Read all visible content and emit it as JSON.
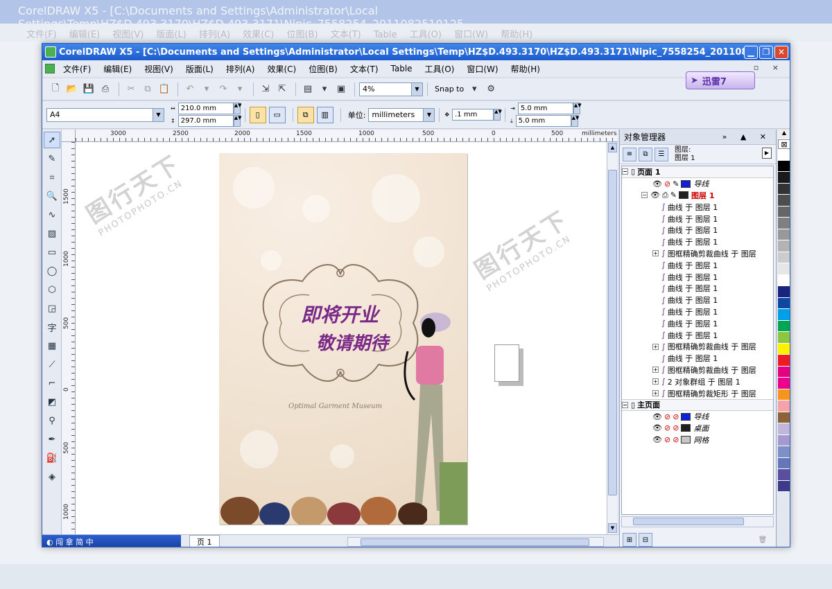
{
  "window": {
    "title": "CorelDRAW X5 - [C:\\Documents and Settings\\Administrator\\Local Settings\\Temp\\HZ$D.493.3170\\HZ$D.493.3171\\Nipic_7558254_2011082510125...",
    "btn_min": "▁",
    "btn_max": "❐",
    "btn_close": "✕"
  },
  "menu": {
    "items": [
      "文件(F)",
      "编辑(E)",
      "视图(V)",
      "版面(L)",
      "排列(A)",
      "效果(C)",
      "位图(B)",
      "文本(T)",
      "Table",
      "工具(O)",
      "窗口(W)",
      "帮助(H)"
    ],
    "mdi": "_ ▫ ×"
  },
  "toolbar": {
    "zoom": "4%",
    "snap": "Snap to",
    "xunlei": "迅雷7"
  },
  "propbar": {
    "paper": "A4",
    "width": "210.0 mm",
    "height": "297.0 mm",
    "unit_label": "单位:",
    "unit": "millimeters",
    "nudge": ".1 mm",
    "dup_x": "5.0 mm",
    "dup_y": "5.0 mm"
  },
  "ruler": {
    "h_labels": [
      "3000",
      "2500",
      "2000",
      "1500",
      "1000",
      "500",
      "0",
      "500"
    ],
    "h_unit": "millimeters",
    "v_labels": [
      "1500",
      "1000",
      "500",
      "0",
      "500",
      "1000"
    ],
    "v_unit": "millimeters"
  },
  "design": {
    "line1": "即将开业",
    "line2": "敬请期待",
    "sub": "Optimal Garment Museum"
  },
  "watermark": {
    "brand": "图行天下",
    "site": "PHOTOPHOTO.CN"
  },
  "status": {
    "ime": "◐ 闯 拿 简 中",
    "page_tab": "页 1"
  },
  "docker": {
    "title": "对象管理器",
    "controls": "» ▲ ✕",
    "layer_label": "图层:",
    "layer_value": "图层 1",
    "page1": "页面 1",
    "guides": "导线",
    "layer1": "图层 1",
    "objects": [
      {
        "expand": false,
        "label": "曲线 于 图层 1"
      },
      {
        "expand": false,
        "label": "曲线 于 图层 1"
      },
      {
        "expand": false,
        "label": "曲线 于 图层 1"
      },
      {
        "expand": false,
        "label": "曲线 于 图层 1"
      },
      {
        "expand": true,
        "label": "图框精确剪裁曲线 于 图层"
      },
      {
        "expand": false,
        "label": "曲线 于 图层 1"
      },
      {
        "expand": false,
        "label": "曲线 于 图层 1"
      },
      {
        "expand": false,
        "label": "曲线 于 图层 1"
      },
      {
        "expand": false,
        "label": "曲线 于 图层 1"
      },
      {
        "expand": false,
        "label": "曲线 于 图层 1"
      },
      {
        "expand": false,
        "label": "曲线 于 图层 1"
      },
      {
        "expand": false,
        "label": "曲线 于 图层 1"
      },
      {
        "expand": true,
        "label": "图框精确剪裁曲线 于 图层"
      },
      {
        "expand": false,
        "label": "曲线 于 图层 1"
      },
      {
        "expand": true,
        "label": "图框精确剪裁曲线 于 图层"
      },
      {
        "expand": true,
        "label": "2 对象群组 于 图层 1"
      },
      {
        "expand": true,
        "label": "图框精确剪裁矩形 于 图层"
      }
    ],
    "master": "主页面",
    "master_layers": [
      {
        "name": "导线",
        "color": "#1020d8"
      },
      {
        "name": "桌面",
        "color": "#202020"
      },
      {
        "name": "网格",
        "color": "#c8c8c8"
      }
    ]
  },
  "palette": [
    "#ffffff",
    "#000000",
    "#1a1a1a",
    "#333333",
    "#4d4d4d",
    "#666666",
    "#808080",
    "#999999",
    "#b3b3b3",
    "#cccccc",
    "#e6e6e6",
    "#ffffff",
    "#1a237e",
    "#0d47a1",
    "#00a0e9",
    "#00a651",
    "#8dc63f",
    "#fff200",
    "#ed1c24",
    "#e4007f",
    "#ec008c",
    "#f7941d",
    "#f5a3a9",
    "#8c6239",
    "#c3b7d9",
    "#a59ad0",
    "#7f8fc8",
    "#6875b8",
    "#5a4f9e",
    "#3d3a8a"
  ]
}
